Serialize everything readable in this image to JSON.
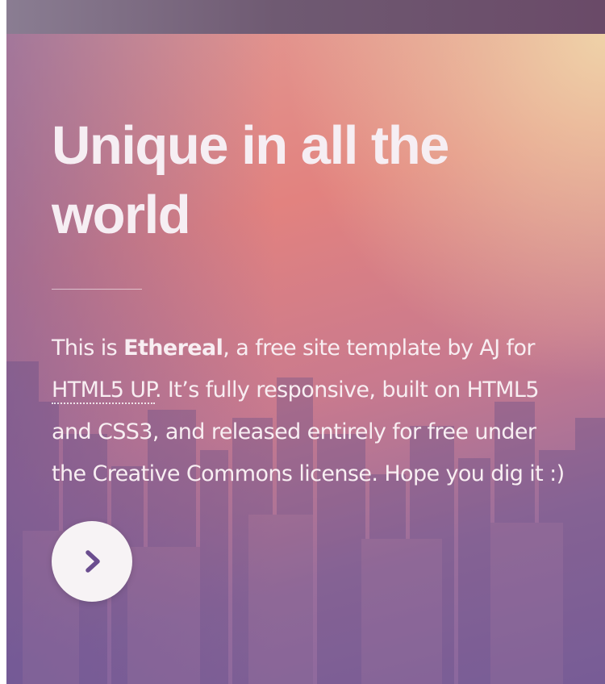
{
  "hero": {
    "headline": "Unique in all the world",
    "intro": {
      "before_brand": "This is ",
      "brand": "Ethereal",
      "after_brand": ", a free site template by AJ for ",
      "link_text": "HTML5 UP",
      "after_link": ". It’s fully responsive, built on HTML5 and CSS3, and released entirely for free under the Creative Commons license. Hope you dig it :)"
    },
    "next_icon": "chevron-right-icon"
  },
  "colors": {
    "icon": "#6b4d8f",
    "text": "#f8eef2"
  }
}
